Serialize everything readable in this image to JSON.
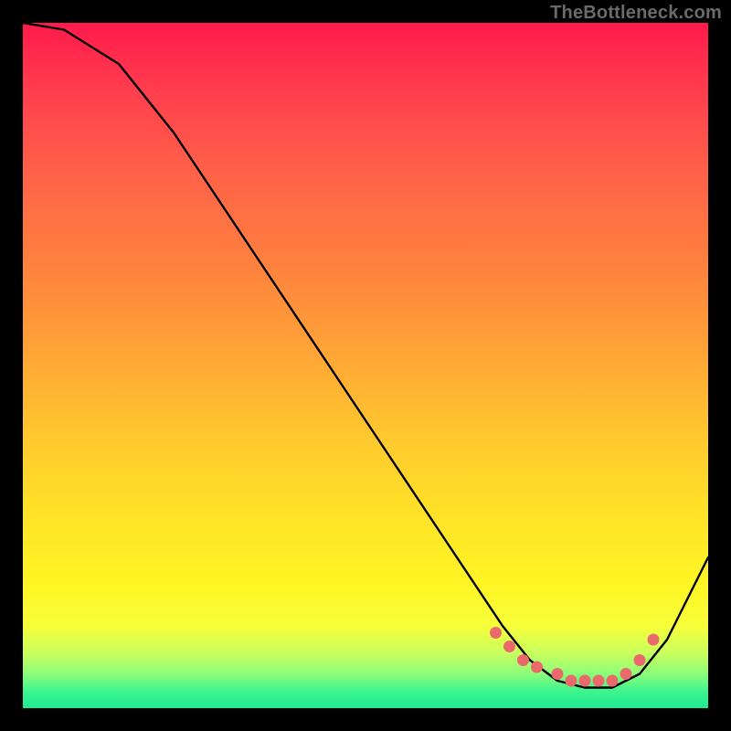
{
  "attribution": "TheBottleneck.com",
  "chart_data": {
    "type": "line",
    "title": "",
    "xlabel": "",
    "ylabel": "",
    "xlim": [
      0,
      100
    ],
    "ylim": [
      0,
      100
    ],
    "series": [
      {
        "name": "curve",
        "x": [
          0,
          6,
          14,
          22,
          30,
          38,
          46,
          54,
          60,
          66,
          70,
          74,
          78,
          82,
          86,
          90,
          94,
          98,
          100
        ],
        "y": [
          100,
          99,
          94,
          84,
          72,
          60,
          48,
          36,
          27,
          18,
          12,
          7,
          4,
          3,
          3,
          5,
          10,
          18,
          22
        ]
      }
    ],
    "markers": {
      "name": "highlight-dots",
      "x": [
        69,
        71,
        73,
        75,
        78,
        80,
        82,
        84,
        86,
        88,
        90,
        92
      ],
      "y": [
        11,
        9,
        7,
        6,
        5,
        4,
        4,
        4,
        4,
        5,
        7,
        10
      ]
    },
    "colors": {
      "line": "#000000",
      "markers": "#ea6a6c",
      "gradient_top": "#ff1a4b",
      "gradient_bottom": "#1ceb93"
    }
  }
}
